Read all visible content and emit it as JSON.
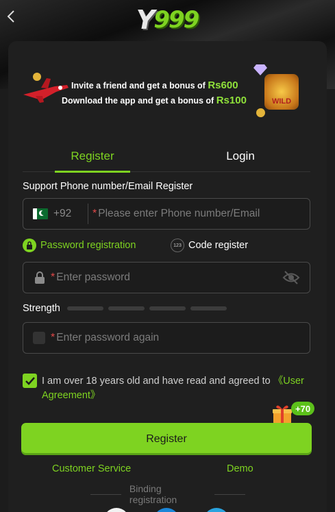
{
  "header": {
    "logo_y": "Y",
    "logo_num": "999"
  },
  "banner": {
    "line1_text": "Invite a friend and get a bonus of ",
    "line1_amount": "Rs600",
    "line2_text": "Download the app and get a bonus of ",
    "line2_amount": "Rs100",
    "wild_label": "WILD"
  },
  "tabs": {
    "register": "Register",
    "login": "Login"
  },
  "form": {
    "section_title": "Support Phone number/Email Register",
    "country_code": "+92",
    "phone_placeholder": "Please enter Phone number/Email",
    "required_mark": "*",
    "option_password": "Password registration",
    "option_code": "Code register",
    "option_code_icon": "123",
    "password_placeholder": "Enter password",
    "strength_label": "Strength",
    "password_again_placeholder": "Enter password again",
    "agree_text": "I am over 18 years old and have read and agreed to ",
    "agree_link": "《User Agreement》",
    "bonus_badge": "+70",
    "register_button": "Register"
  },
  "footer": {
    "customer_service": "Customer Service",
    "demo": "Demo",
    "binding_title": "Binding registration"
  },
  "colors": {
    "accent": "#7ed321",
    "background": "#1c1c1c",
    "required": "#e04848"
  },
  "icons": [
    "back-chevron-icon",
    "pakistan-flag-icon",
    "lock-icon",
    "eye-off-icon",
    "checkmark-icon",
    "gift-icon",
    "airplane-icon",
    "coin-icon",
    "diamond-icon",
    "wild-slot-icon"
  ]
}
